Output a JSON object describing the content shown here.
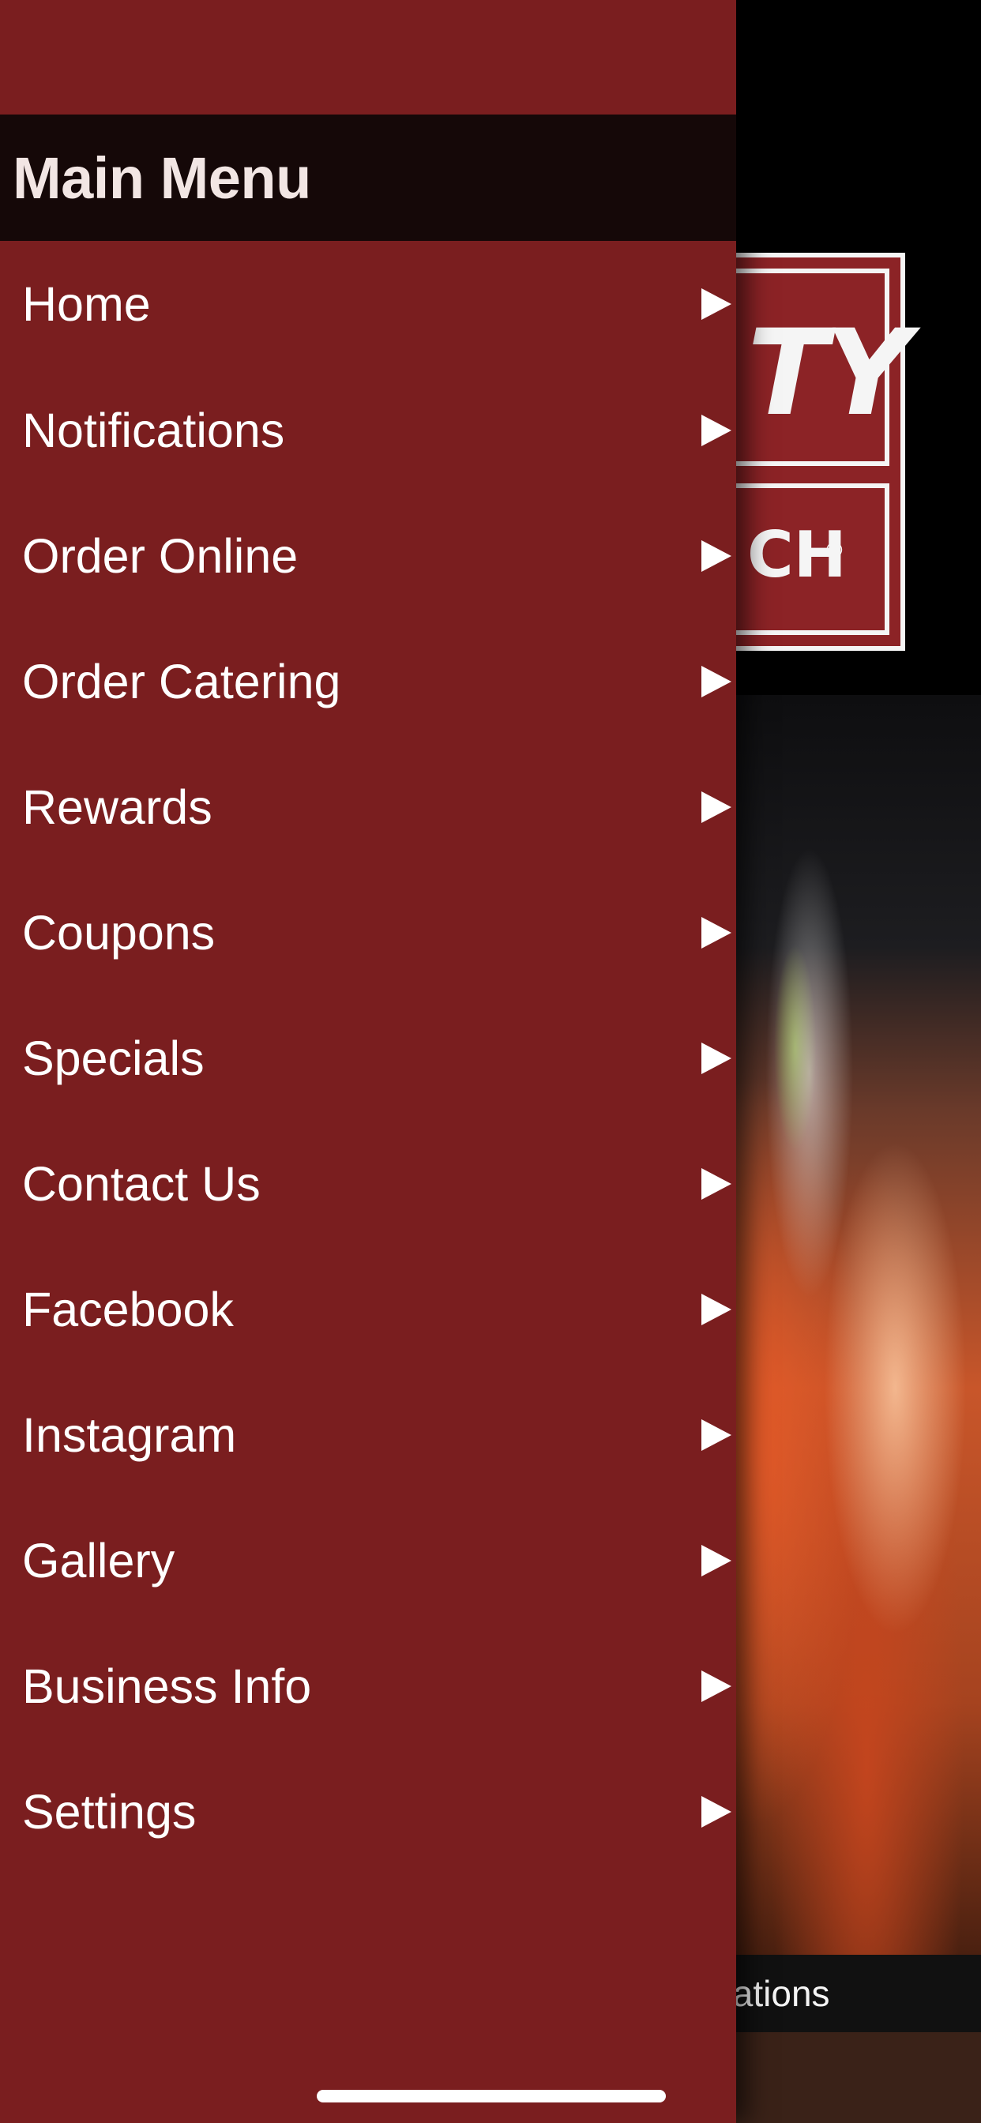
{
  "menu": {
    "title": "Main Menu",
    "items": [
      {
        "label": "Home",
        "icon": "chevron-right-icon"
      },
      {
        "label": "Notifications",
        "icon": "chevron-right-icon"
      },
      {
        "label": "Order Online",
        "icon": "chevron-right-icon"
      },
      {
        "label": "Order Catering",
        "icon": "chevron-right-icon"
      },
      {
        "label": "Rewards",
        "icon": "chevron-right-icon"
      },
      {
        "label": "Coupons",
        "icon": "chevron-right-icon"
      },
      {
        "label": "Specials",
        "icon": "chevron-right-icon"
      },
      {
        "label": "Contact Us",
        "icon": "chevron-right-icon"
      },
      {
        "label": "Facebook",
        "icon": "chevron-right-icon"
      },
      {
        "label": "Instagram",
        "icon": "chevron-right-icon"
      },
      {
        "label": "Gallery",
        "icon": "chevron-right-icon"
      },
      {
        "label": "Business Info",
        "icon": "chevron-right-icon"
      },
      {
        "label": "Settings",
        "icon": "chevron-right-icon"
      }
    ]
  },
  "background": {
    "logo_top_text": "TY",
    "logo_bottom_text": "CH",
    "logo_reg": "®",
    "notif_bar_label": "Notifications"
  },
  "colors": {
    "drawer_bg": "#7a1e1f",
    "header_bg": "#150808",
    "logo_red": "#8c2326"
  }
}
